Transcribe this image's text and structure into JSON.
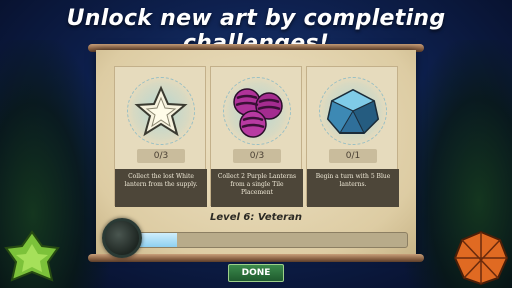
{
  "title": "Unlock new art by completing challenges!",
  "challenges": [
    {
      "icon": "white-star-lantern-icon",
      "progress": "0/3",
      "description": "Collect the lost White lantern from the supply."
    },
    {
      "icon": "purple-lanterns-icon",
      "progress": "0/3",
      "description": "Collect 2 Purple Lanterns from a single Tile Placement"
    },
    {
      "icon": "blue-lantern-icon",
      "progress": "0/1",
      "description": "Begin a turn with 5 Blue lanterns."
    }
  ],
  "level": {
    "label": "Level 6: Veteran",
    "progress_fraction": 0.24
  },
  "done_label": "DONE",
  "colors": {
    "background": "#0e2150",
    "parchment": "#e6dbbd",
    "description_panel": "#4d4639",
    "done_button": "#2d7a3e",
    "progress_fill": "#9fd6f2"
  }
}
